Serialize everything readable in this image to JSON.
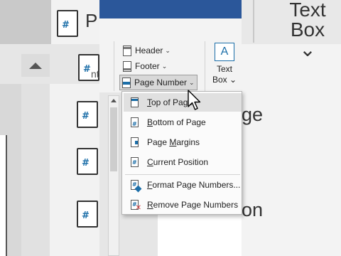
{
  "background_left": {
    "partial_text": "nt",
    "big_letter": "P"
  },
  "background_right": {
    "top_label_line1": "Text",
    "top_label_line2": "Box ⌄",
    "fragment_mid": "ge",
    "fragment_bottom": "on"
  },
  "ribbon": {
    "header_label": "Header",
    "footer_label": "Footer",
    "page_number_label": "Page Number",
    "textbox_line1": "Text",
    "textbox_line2": "Box ⌄",
    "textbox_icon": "A",
    "chevron": "⌄"
  },
  "menu": {
    "items": [
      {
        "pre": "",
        "u": "T",
        "post": "op of Page",
        "icon": "page-top-icon"
      },
      {
        "pre": "",
        "u": "B",
        "post": "ottom of Page",
        "icon": "page-bottom-icon"
      },
      {
        "pre": "Page ",
        "u": "M",
        "post": "argins",
        "icon": "page-margins-icon"
      },
      {
        "pre": "",
        "u": "C",
        "post": "urrent Position",
        "icon": "current-position-icon"
      },
      {
        "pre": "",
        "u": "F",
        "post": "ormat Page Numbers...",
        "icon": "format-page-numbers-icon"
      },
      {
        "pre": "",
        "u": "R",
        "post": "emove Page Numbers",
        "icon": "remove-page-numbers-icon"
      }
    ]
  },
  "colors": {
    "accent": "#1b6ea8",
    "title_bar": "#2b579a",
    "remove_red": "#d13438"
  }
}
